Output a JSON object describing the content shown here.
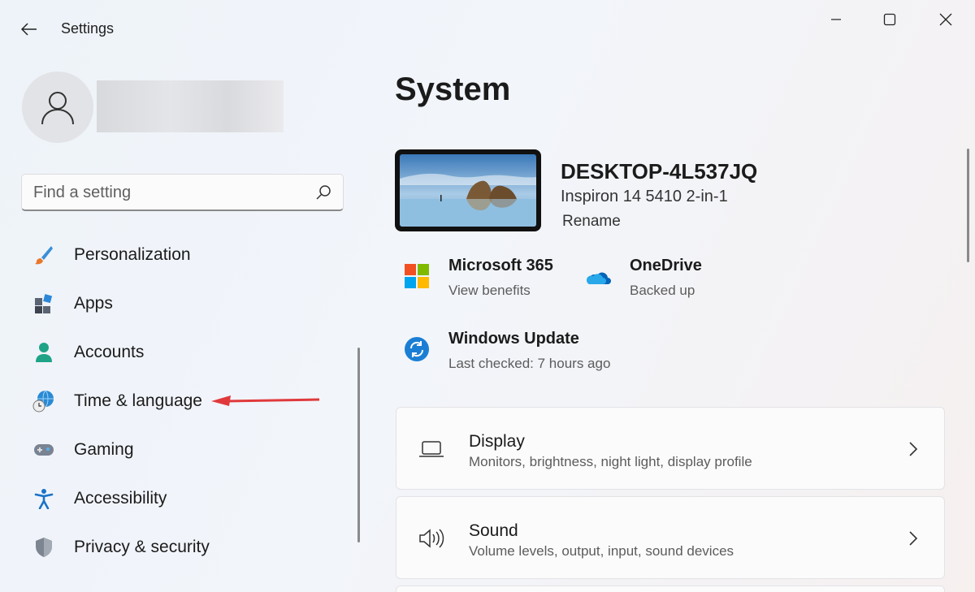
{
  "window": {
    "title": "Settings",
    "controls": [
      "minimize",
      "maximize",
      "close"
    ]
  },
  "search": {
    "placeholder": "Find a setting"
  },
  "sidebar": {
    "items": [
      {
        "label": "Personalization",
        "icon": "brush-icon"
      },
      {
        "label": "Apps",
        "icon": "apps-icon"
      },
      {
        "label": "Accounts",
        "icon": "person-icon"
      },
      {
        "label": "Time & language",
        "icon": "globe-clock-icon"
      },
      {
        "label": "Gaming",
        "icon": "gamepad-icon"
      },
      {
        "label": "Accessibility",
        "icon": "accessibility-icon"
      },
      {
        "label": "Privacy & security",
        "icon": "shield-icon"
      }
    ]
  },
  "main": {
    "title": "System",
    "device": {
      "name": "DESKTOP-4L537JQ",
      "model": "Inspiron 14 5410 2-in-1",
      "rename": "Rename"
    },
    "tiles": [
      {
        "title": "Microsoft 365",
        "subtitle": "View benefits",
        "icon": "microsoft-logo-icon"
      },
      {
        "title": "OneDrive",
        "subtitle": "Backed up",
        "icon": "cloud-icon"
      },
      {
        "title": "Windows Update",
        "subtitle": "Last checked: 7 hours ago",
        "icon": "update-icon"
      }
    ],
    "cards": [
      {
        "title": "Display",
        "subtitle": "Monitors, brightness, night light, display profile",
        "icon": "laptop-icon"
      },
      {
        "title": "Sound",
        "subtitle": "Volume levels, output, input, sound devices",
        "icon": "speaker-icon"
      }
    ]
  },
  "colors": {
    "accent": "#0067c0",
    "annotation_arrow": "#e0393b"
  }
}
